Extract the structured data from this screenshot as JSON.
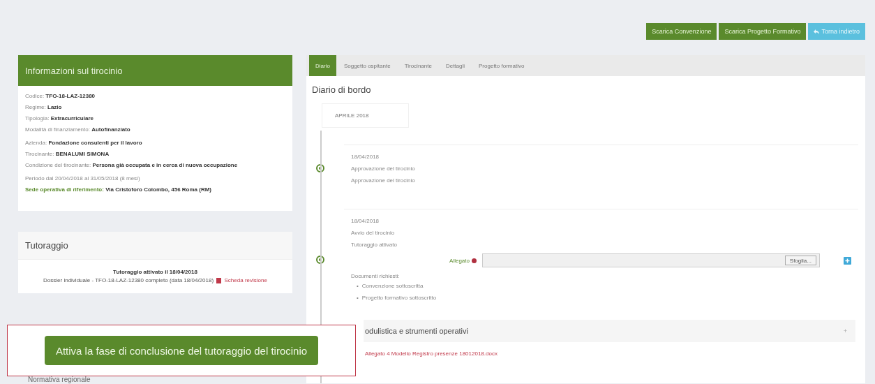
{
  "toolbar": {
    "buttons": [
      {
        "label": "Scarica Convenzione",
        "kind": "download"
      },
      {
        "label": "Scarica Progetto Formativo",
        "kind": "download"
      },
      {
        "label": "Torna indietro",
        "kind": "back"
      }
    ]
  },
  "info_panel": {
    "title": "Informazioni sul tirocinio",
    "groups": [
      [
        {
          "label": "Codice:",
          "value": "TFO-18-LAZ-12380",
          "kind": "field"
        },
        {
          "label": "Regime:",
          "value": "Lazio",
          "kind": "field"
        },
        {
          "label": "Tipologia:",
          "value": "Extracurriculare",
          "kind": "field"
        },
        {
          "label": "Modalità di finanziamento:",
          "value": "Autofinanziato",
          "kind": "field"
        }
      ],
      [
        {
          "label": "Azienda:",
          "value": "Fondazione consulenti per il lavoro",
          "kind": "field"
        },
        {
          "label": "Tirocinante:",
          "value": "BENALUMI SIMONA",
          "kind": "field"
        },
        {
          "label": "Condizione del tirocinante:",
          "value": "Persona già occupata e in cerca di nuova occupazione",
          "kind": "field"
        }
      ],
      [
        {
          "label": "Periodo dal 20/04/2018 al 31/05/2018 (8 mesi)",
          "kind": "text"
        },
        {
          "label": "Sede operativa di riferimento:",
          "value": "Via Cristoforo Colombo, 456 Roma (RM)",
          "kind": "highlight"
        }
      ]
    ]
  },
  "tutoraggio": {
    "title": "Tutoraggio",
    "status": "Tutoraggio attivato il 18/04/2018",
    "dossier": "Dossier individuale - TFO-18-LAZ-12380 completo (data 18/04/2018)",
    "link": "Scheda revisione"
  },
  "callout": {
    "label": "Attiva la fase di conclusione del tutoraggio del tirocinio"
  },
  "normativa": {
    "title": "Normativa regionale"
  },
  "main": {
    "tabs": [
      {
        "label": "Diario",
        "selected": true
      },
      {
        "label": "Soggetto ospitante",
        "selected": false
      },
      {
        "label": "Tirocinante",
        "selected": false
      },
      {
        "label": "Dettagli",
        "selected": false
      },
      {
        "label": "Progetto formativo",
        "selected": false
      }
    ],
    "title": "Diario di bordo",
    "month": "APRILE 2018",
    "entries": [
      {
        "date": "18/04/2018",
        "items": [
          {
            "kind": "text",
            "text": "Approvazione del tirocinio"
          },
          {
            "kind": "text",
            "text": "Approvazione del tirocinio"
          }
        ]
      },
      {
        "date": "18/04/2018",
        "items": [
          {
            "kind": "text",
            "text": "Avvio del tirocinio"
          },
          {
            "kind": "text",
            "text": "Tutoraggio attivato"
          },
          {
            "kind": "upload",
            "label": "Allegato",
            "button": "Sfoglia..."
          },
          {
            "kind": "list",
            "text": "Documenti richiesti:",
            "entries": [
              {
                "marker": "•",
                "text": "Convenzione sottoscritta"
              },
              {
                "marker": "•",
                "text": "Progetto formativo sottoscritto"
              }
            ]
          }
        ]
      }
    ],
    "modulistica": {
      "title": "odulistica e strumenti operativi",
      "toggle": "+",
      "attachment": "Allegato 4 Modello Registro presenze 18012018.docx"
    }
  }
}
